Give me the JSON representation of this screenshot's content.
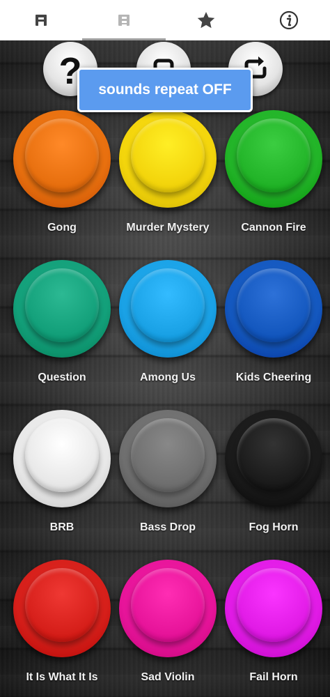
{
  "tabs": [
    {
      "name": "tab-a",
      "icon": "letter-a-icon",
      "label": "A"
    },
    {
      "name": "tab-b",
      "icon": "letter-b-icon",
      "label": "B"
    },
    {
      "name": "tab-favorites",
      "icon": "star-icon"
    },
    {
      "name": "tab-info",
      "icon": "info-icon"
    }
  ],
  "controls": {
    "help_icon": "question-mark-icon",
    "help_glyph": "?",
    "stop_icon": "stop-icon",
    "repeat_icon": "repeat-icon"
  },
  "toast": {
    "text": "sounds repeat OFF"
  },
  "sounds": [
    {
      "label": "Gong",
      "color": "#e8700f"
    },
    {
      "label": "Murder Mystery",
      "color": "#f3d50c"
    },
    {
      "label": "Cannon Fire",
      "color": "#22b428"
    },
    {
      "label": "Question",
      "color": "#13a07a"
    },
    {
      "label": "Among Us",
      "color": "#1aa2e6"
    },
    {
      "label": "Kids Cheering",
      "color": "#1458bf"
    },
    {
      "label": "BRB",
      "color": "#e8e8e8"
    },
    {
      "label": "Bass Drop",
      "color": "#6f6f6f"
    },
    {
      "label": "Fog Horn",
      "color": "#1a1a1a"
    },
    {
      "label": "It Is What It Is",
      "color": "#d61f1a"
    },
    {
      "label": "Sad Violin",
      "color": "#e7149a"
    },
    {
      "label": "Fail Horn",
      "color": "#e11be6"
    }
  ],
  "colors": {
    "tab_active_indicator": "#9e9e9e",
    "toast_background": "#5b9bef",
    "label_text": "#f2f2f2"
  }
}
